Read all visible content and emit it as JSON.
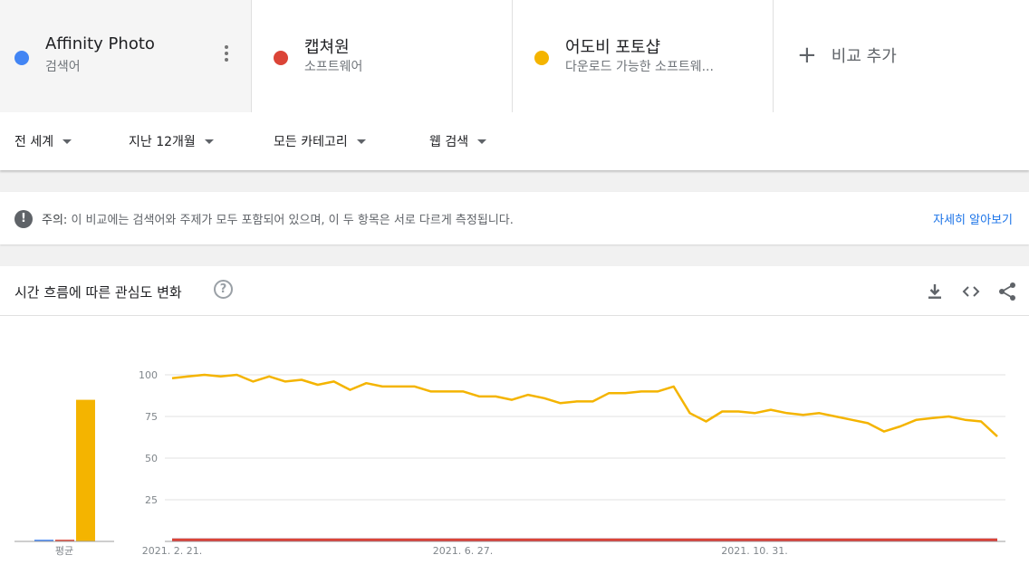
{
  "terms": [
    {
      "name": "Affinity Photo",
      "type": "검색어",
      "color": "#4285f4"
    },
    {
      "name": "캡쳐원",
      "type": "소프트웨어",
      "color": "#db4437"
    },
    {
      "name": "어도비 포토샵",
      "type": "다운로드 가능한 소프트웨...",
      "color": "#f4b400"
    }
  ],
  "add_term_label": "비교 추가",
  "filters": {
    "region": "전 세계",
    "period": "지난 12개월",
    "category": "모든 카테고리",
    "search_type": "웹 검색"
  },
  "notice": {
    "prefix": "주의:",
    "message": "이 비교에는 검색어와 주제가 모두 포함되어 있으며, 이 두 항목은 서로 다르게 측정됩니다.",
    "link": "자세히 알아보기"
  },
  "card": {
    "title": "시간 흐름에 따른 관심도 변화",
    "icons": [
      "download-icon",
      "embed-code-icon",
      "share-icon"
    ]
  },
  "chart_data": {
    "type": "line",
    "x_tick_labels": [
      "2021. 2. 21.",
      "2021. 6. 27.",
      "2021. 10. 31."
    ],
    "y_ticks": [
      25,
      50,
      75,
      100
    ],
    "ylim": [
      0,
      100
    ],
    "grid": true,
    "average_label": "평균",
    "averages": [
      {
        "name": "Affinity Photo",
        "value": 1,
        "color": "#4285f4"
      },
      {
        "name": "캡쳐원",
        "value": 1,
        "color": "#db4437"
      },
      {
        "name": "어도비 포토샵",
        "value": 85,
        "color": "#f4b400"
      }
    ],
    "series": [
      {
        "name": "Affinity Photo",
        "color": "#4285f4",
        "values": [
          1,
          1,
          1,
          1,
          1,
          1,
          1,
          1,
          1,
          1,
          1,
          1,
          1,
          1,
          1,
          1,
          1,
          1,
          1,
          1,
          1,
          1,
          1,
          1,
          1,
          1,
          1,
          1,
          1,
          1,
          1,
          1,
          1,
          1,
          1,
          1,
          1,
          1,
          1,
          1,
          1,
          1,
          1,
          1,
          1,
          1,
          1,
          1,
          1,
          1,
          1,
          1,
          1,
          1
        ]
      },
      {
        "name": "캡쳐원",
        "color": "#db4437",
        "values": [
          1,
          1,
          1,
          1,
          1,
          1,
          1,
          1,
          1,
          1,
          1,
          1,
          1,
          1,
          1,
          1,
          1,
          1,
          1,
          1,
          1,
          1,
          1,
          1,
          1,
          1,
          1,
          1,
          1,
          1,
          1,
          1,
          1,
          1,
          1,
          1,
          1,
          1,
          1,
          1,
          1,
          1,
          1,
          1,
          1,
          1,
          1,
          1,
          1,
          1,
          1,
          1,
          1,
          1
        ]
      },
      {
        "name": "어도비 포토샵",
        "color": "#f4b400",
        "values": [
          98,
          99,
          100,
          99,
          100,
          96,
          99,
          96,
          97,
          94,
          96,
          91,
          95,
          93,
          93,
          93,
          90,
          90,
          90,
          87,
          87,
          85,
          88,
          86,
          83,
          84,
          84,
          89,
          89,
          90,
          90,
          93,
          77,
          72,
          78,
          78,
          77,
          79,
          77,
          76,
          77,
          75,
          73,
          71,
          66,
          69,
          73,
          74,
          75,
          73,
          72,
          63
        ]
      }
    ]
  }
}
